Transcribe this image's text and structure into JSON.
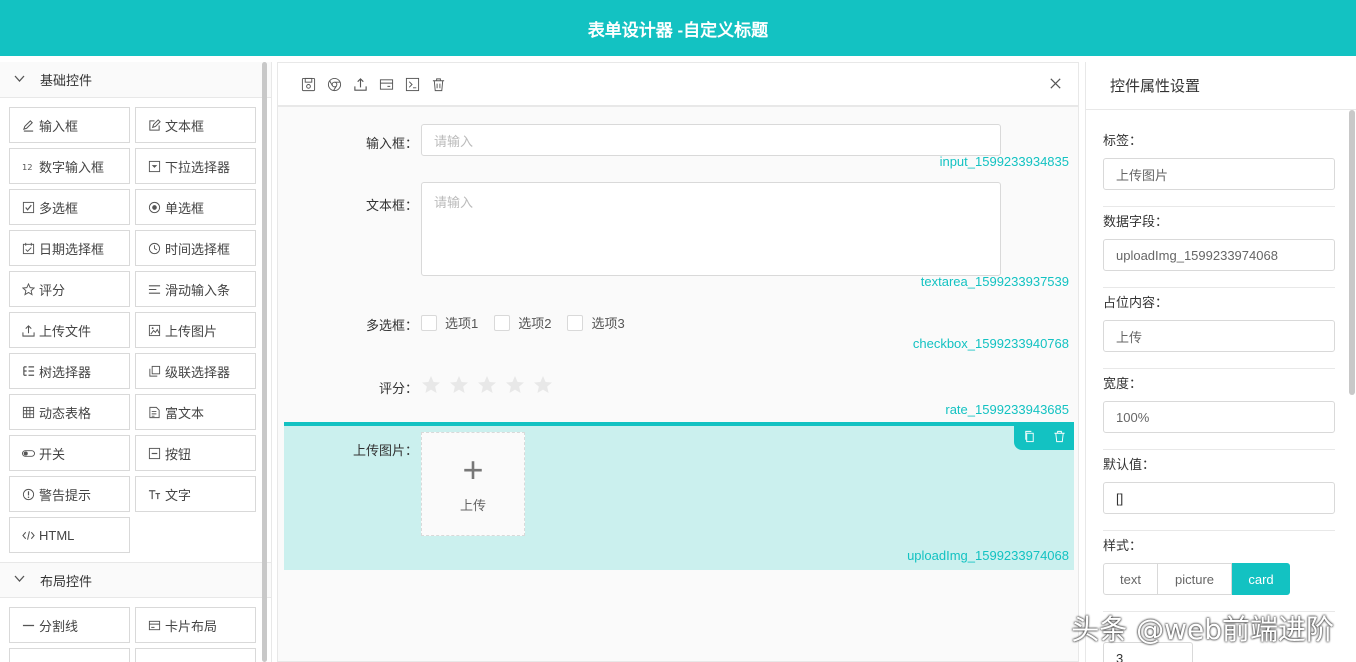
{
  "app": {
    "title": "表单设计器 -自定义标题"
  },
  "left": {
    "basic_title": "基础控件",
    "basic_items": [
      {
        "label": "输入框",
        "icon": "edit-icon"
      },
      {
        "label": "文本框",
        "icon": "form-icon"
      },
      {
        "label": "数字输入框",
        "icon": "number-icon"
      },
      {
        "label": "下拉选择器",
        "icon": "select-icon"
      },
      {
        "label": "多选框",
        "icon": "checkbox-icon"
      },
      {
        "label": "单选框",
        "icon": "radio-icon"
      },
      {
        "label": "日期选择框",
        "icon": "calendar-icon"
      },
      {
        "label": "时间选择框",
        "icon": "clock-icon"
      },
      {
        "label": "评分",
        "icon": "star-icon"
      },
      {
        "label": "滑动输入条",
        "icon": "slider-icon"
      },
      {
        "label": "上传文件",
        "icon": "upload-icon"
      },
      {
        "label": "上传图片",
        "icon": "image-icon"
      },
      {
        "label": "树选择器",
        "icon": "tree-icon"
      },
      {
        "label": "级联选择器",
        "icon": "cascader-icon"
      },
      {
        "label": "动态表格",
        "icon": "table-icon"
      },
      {
        "label": "富文本",
        "icon": "richtext-icon"
      },
      {
        "label": "开关",
        "icon": "switch-icon"
      },
      {
        "label": "按钮",
        "icon": "button-icon"
      },
      {
        "label": "警告提示",
        "icon": "alert-icon"
      },
      {
        "label": "文字",
        "icon": "text-icon"
      },
      {
        "label": "HTML",
        "icon": "code-icon"
      }
    ],
    "layout_title": "布局控件",
    "layout_items": [
      {
        "label": "分割线",
        "icon": "divider-icon"
      },
      {
        "label": "卡片布局",
        "icon": "card-icon"
      }
    ]
  },
  "center": {
    "toolbar_icons": [
      "save-icon",
      "chrome-icon",
      "export-icon",
      "card-icon",
      "terminal-icon",
      "delete-icon"
    ],
    "fields": {
      "input": {
        "label": "输入框：",
        "placeholder": "请输入",
        "id": "input_1599233934835"
      },
      "textarea": {
        "label": "文本框：",
        "placeholder": "请输入",
        "id": "textarea_1599233937539"
      },
      "checkbox": {
        "label": "多选框：",
        "options": [
          "选项1",
          "选项2",
          "选项3"
        ],
        "id": "checkbox_1599233940768"
      },
      "rate": {
        "label": "评分：",
        "value": 0,
        "max": 5,
        "id": "rate_1599233943685"
      },
      "upload": {
        "label": "上传图片：",
        "button_text": "上传",
        "id": "uploadImg_1599233974068"
      }
    }
  },
  "right": {
    "title": "控件属性设置",
    "props": {
      "label": {
        "name": "标签：",
        "value": "上传图片"
      },
      "model": {
        "name": "数据字段：",
        "value": "uploadImg_1599233974068"
      },
      "placeholder": {
        "name": "占位内容：",
        "value": "上传"
      },
      "width": {
        "name": "宽度：",
        "value": "100%"
      },
      "default": {
        "name": "默认值：",
        "value": "[]"
      },
      "style": {
        "name": "样式：",
        "options": [
          "text",
          "picture",
          "card"
        ],
        "selected": "card"
      },
      "limit": {
        "value": "3"
      }
    }
  },
  "watermark": "头条 @web前端进阶",
  "colors": {
    "accent": "#13c2c2",
    "active_bg": "#cbf0ee"
  }
}
